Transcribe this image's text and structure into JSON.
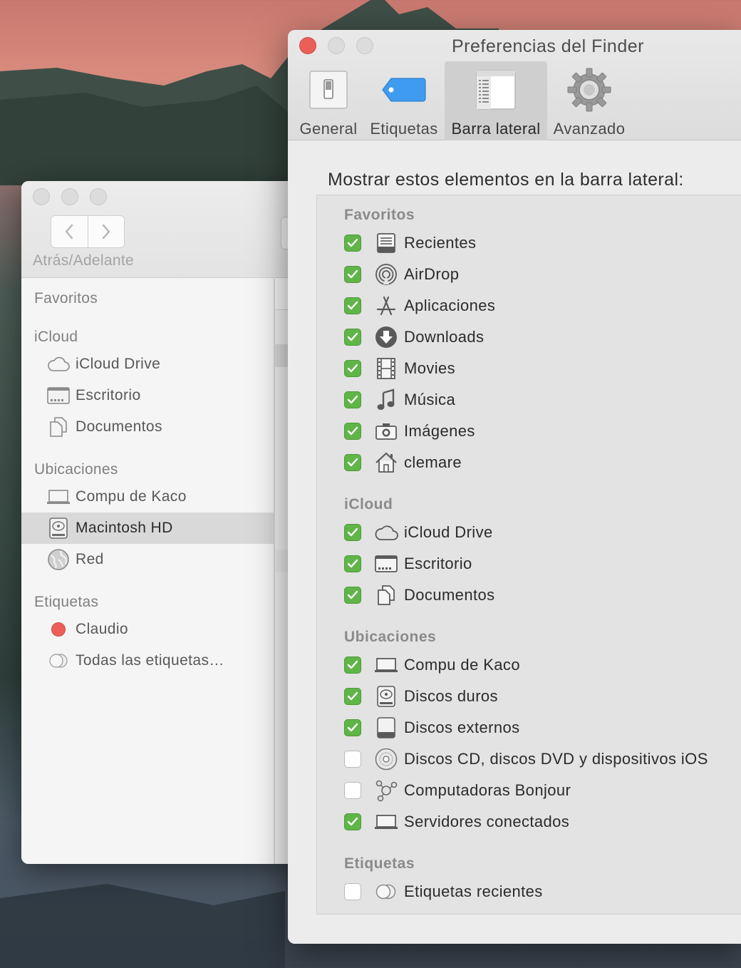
{
  "colors": {
    "checkbox_checked": "#5fb547",
    "close_button": "#ec5f58",
    "tag_claudio": "#ec5f58"
  },
  "finder": {
    "nav_label": "Atrás/Adelante",
    "sidebar": {
      "sections": [
        {
          "title": "Favoritos",
          "items": []
        },
        {
          "title": "iCloud",
          "items": [
            {
              "label": "iCloud Drive",
              "icon": "cloud-icon"
            },
            {
              "label": "Escritorio",
              "icon": "desktop-icon"
            },
            {
              "label": "Documentos",
              "icon": "documents-icon"
            }
          ]
        },
        {
          "title": "Ubicaciones",
          "items": [
            {
              "label": "Compu de Kaco",
              "icon": "laptop-icon"
            },
            {
              "label": "Macintosh HD",
              "icon": "hard-disk-icon",
              "selected": true
            },
            {
              "label": "Red",
              "icon": "network-icon"
            }
          ]
        },
        {
          "title": "Etiquetas",
          "items": [
            {
              "label": "Claudio",
              "icon": "red-tag-icon"
            },
            {
              "label": "Todas las etiquetas…",
              "icon": "all-tags-icon"
            }
          ]
        }
      ]
    }
  },
  "prefs": {
    "title": "Preferencias del Finder",
    "tabs": [
      {
        "label": "General",
        "icon": "switch-icon"
      },
      {
        "label": "Etiquetas",
        "icon": "tag-icon"
      },
      {
        "label": "Barra lateral",
        "icon": "sidebar-icon",
        "active": true
      },
      {
        "label": "Avanzado",
        "icon": "gear-icon"
      }
    ],
    "heading": "Mostrar estos elementos en la barra lateral:",
    "groups": [
      {
        "title": "Favoritos",
        "options": [
          {
            "label": "Recientes",
            "checked": true,
            "icon": "recents-icon"
          },
          {
            "label": "AirDrop",
            "checked": true,
            "icon": "airdrop-icon"
          },
          {
            "label": "Aplicaciones",
            "checked": true,
            "icon": "applications-icon"
          },
          {
            "label": "Downloads",
            "checked": true,
            "icon": "downloads-icon"
          },
          {
            "label": "Movies",
            "checked": true,
            "icon": "film-icon"
          },
          {
            "label": "Música",
            "checked": true,
            "icon": "music-note-icon"
          },
          {
            "label": "Imágenes",
            "checked": true,
            "icon": "camera-icon"
          },
          {
            "label": "clemare",
            "checked": true,
            "icon": "home-icon"
          }
        ]
      },
      {
        "title": "iCloud",
        "options": [
          {
            "label": "iCloud Drive",
            "checked": true,
            "icon": "cloud-icon"
          },
          {
            "label": "Escritorio",
            "checked": true,
            "icon": "desktop-icon"
          },
          {
            "label": "Documentos",
            "checked": true,
            "icon": "documents-icon"
          }
        ]
      },
      {
        "title": "Ubicaciones",
        "options": [
          {
            "label": "Compu de Kaco",
            "checked": true,
            "icon": "laptop-icon"
          },
          {
            "label": "Discos duros",
            "checked": true,
            "icon": "hard-disk-icon"
          },
          {
            "label": "Discos externos",
            "checked": true,
            "icon": "external-disk-icon"
          },
          {
            "label": "Discos CD, discos DVD y dispositivos iOS",
            "checked": false,
            "icon": "cd-icon"
          },
          {
            "label": "Computadoras Bonjour",
            "checked": false,
            "icon": "bonjour-icon"
          },
          {
            "label": "Servidores conectados",
            "checked": true,
            "icon": "server-icon"
          }
        ]
      },
      {
        "title": "Etiquetas",
        "options": [
          {
            "label": "Etiquetas recientes",
            "checked": false,
            "icon": "all-tags-icon"
          }
        ]
      }
    ]
  }
}
